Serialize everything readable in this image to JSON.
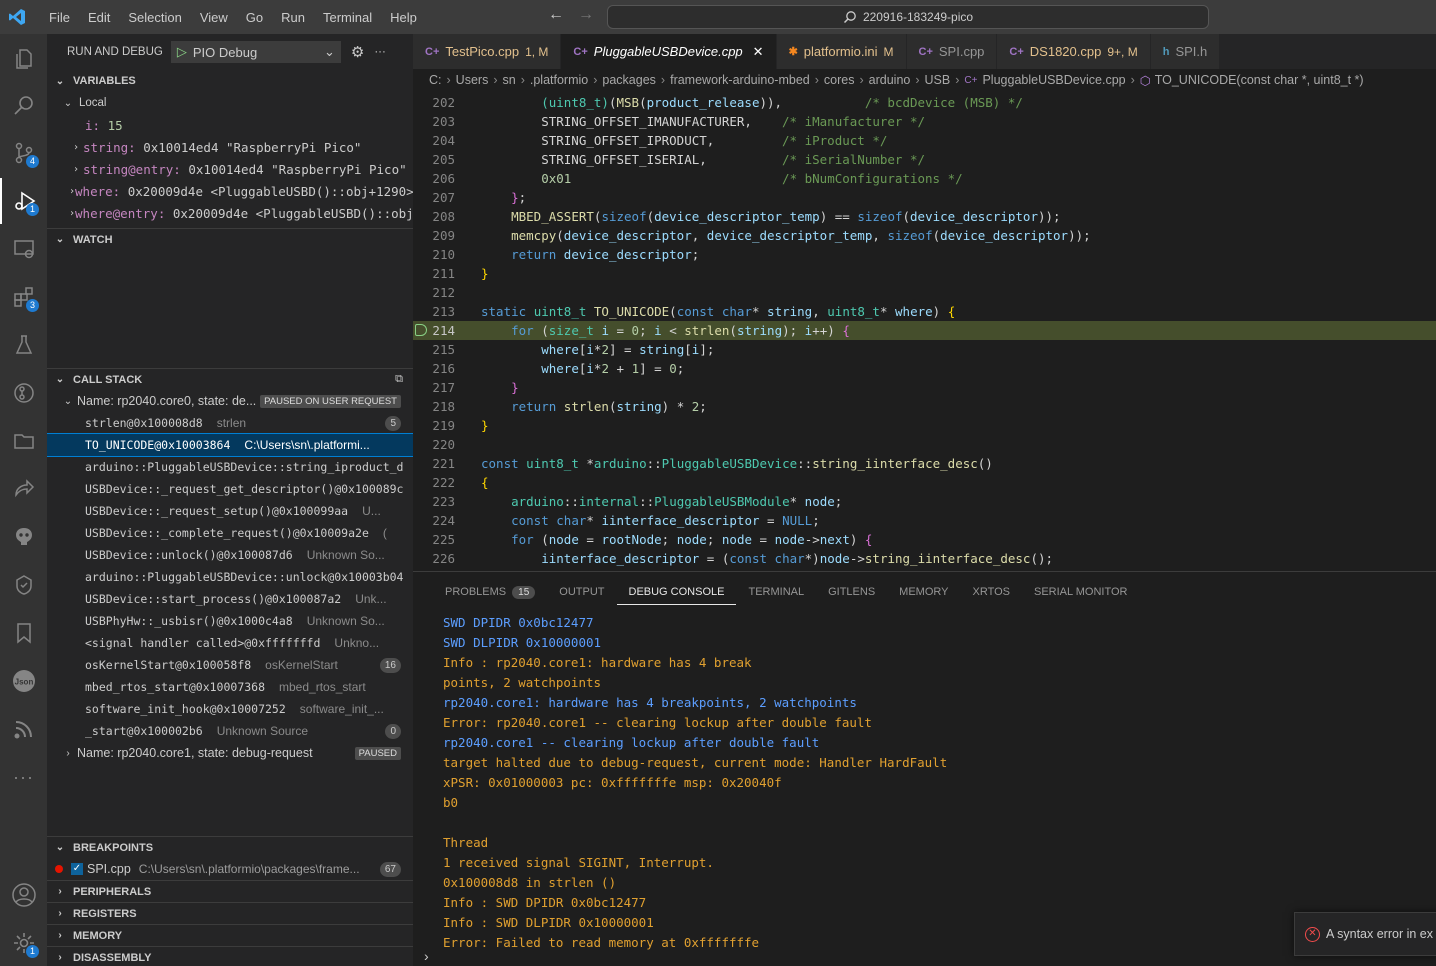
{
  "titlebar": {
    "menus": [
      "File",
      "Edit",
      "Selection",
      "View",
      "Go",
      "Run",
      "Terminal",
      "Help"
    ],
    "search": "220916-183249-pico"
  },
  "activity": {
    "badges": {
      "scm": "4",
      "debug": "1",
      "extensions": "3",
      "settings": "1"
    }
  },
  "sidebar": {
    "header": "RUN AND DEBUG",
    "config": "PIO Debug",
    "variables_title": "VARIABLES",
    "local_title": "Local",
    "vars": [
      {
        "name": "i:",
        "value": "15"
      },
      {
        "name": "string:",
        "value": "0x10014ed4 \"RaspberryPi Pico\""
      },
      {
        "name": "string@entry:",
        "value": "0x10014ed4 \"RaspberryPi Pico\""
      },
      {
        "name": "where:",
        "value": "0x20009d4e <PluggableUSBD()::obj+1290>..."
      },
      {
        "name": "where@entry:",
        "value": "0x20009d4e <PluggableUSBD()::obj..."
      }
    ],
    "watch_title": "WATCH",
    "callstack_title": "CALL STACK",
    "thread0": "Name: rp2040.core0, state: de...",
    "thread0_state": "PAUSED ON USER REQUEST",
    "frames": [
      {
        "fn": "strlen@0x100008d8",
        "src": "strlen",
        "count": "5"
      },
      {
        "fn": "TO_UNICODE@0x10003864",
        "src": "C:\\Users\\sn\\.platformi...",
        "count": ""
      },
      {
        "fn": "arduino::PluggableUSBDevice::string_iproduct_d",
        "src": "",
        "count": ""
      },
      {
        "fn": "USBDevice::_request_get_descriptor()@0x100089c",
        "src": "",
        "count": ""
      },
      {
        "fn": "USBDevice::_request_setup()@0x100099aa",
        "src": "U...",
        "count": ""
      },
      {
        "fn": "USBDevice::_complete_request()@0x10009a2e",
        "src": "(",
        "count": ""
      },
      {
        "fn": "USBDevice::unlock()@0x100087d6",
        "src": "Unknown So...",
        "count": ""
      },
      {
        "fn": "arduino::PluggableUSBDevice::unlock@0x10003b04",
        "src": "",
        "count": ""
      },
      {
        "fn": "USBDevice::start_process()@0x100087a2",
        "src": "Unk...",
        "count": ""
      },
      {
        "fn": "USBPhyHw::_usbisr()@0x1000c4a8",
        "src": "Unknown So...",
        "count": ""
      },
      {
        "fn": "<signal handler called>@0xfffffffd",
        "src": "Unkno...",
        "count": ""
      },
      {
        "fn": "osKernelStart@0x100058f8",
        "src": "osKernelStart",
        "count": "16"
      },
      {
        "fn": "mbed_rtos_start@0x10007368",
        "src": "mbed_rtos_start",
        "count": ""
      },
      {
        "fn": "software_init_hook@0x10007252",
        "src": "software_init_...",
        "count": ""
      },
      {
        "fn": "_start@0x100002b6",
        "src": "Unknown Source",
        "count": "0"
      }
    ],
    "thread1": "Name: rp2040.core1, state: debug-request",
    "thread1_state": "PAUSED",
    "breakpoints_title": "BREAKPOINTS",
    "breakpoint": {
      "file": "SPI.cpp",
      "path": "C:\\Users\\sn\\.platformio\\packages\\frame...",
      "line": "67"
    },
    "peripherals": "PERIPHERALS",
    "registers": "REGISTERS",
    "memory": "MEMORY",
    "disassembly": "DISASSEMBLY"
  },
  "tabs": [
    {
      "label": "TestPico.cpp",
      "suffix": "1, M",
      "icon": "C+"
    },
    {
      "label": "PluggableUSBDevice.cpp",
      "suffix": "",
      "icon": "C+"
    },
    {
      "label": "platformio.ini",
      "suffix": "M",
      "icon": "✱"
    },
    {
      "label": "SPI.cpp",
      "suffix": "",
      "icon": "C+"
    },
    {
      "label": "DS1820.cpp",
      "suffix": "9+, M",
      "icon": "C+"
    },
    {
      "label": "SPI.h",
      "suffix": "",
      "icon": "h"
    }
  ],
  "breadcrumb": [
    "C:",
    "Users",
    "sn",
    ".platformio",
    "packages",
    "framework-arduino-mbed",
    "cores",
    "arduino",
    "USB",
    "PluggableUSBDevice.cpp",
    "TO_UNICODE(const char *, uint8_t *)"
  ],
  "editor": {
    "line_numbers": [
      "202",
      "203",
      "204",
      "205",
      "206",
      "207",
      "208",
      "209",
      "210",
      "211",
      "212",
      "213",
      "214",
      "215",
      "216",
      "217",
      "218",
      "219",
      "220",
      "221",
      "222",
      "223",
      "224",
      "225",
      "226"
    ]
  },
  "panel": {
    "tabs": [
      "PROBLEMS",
      "OUTPUT",
      "DEBUG CONSOLE",
      "TERMINAL",
      "GITLENS",
      "MEMORY",
      "XRTOS",
      "SERIAL MONITOR"
    ],
    "problems_count": "15",
    "console": [
      {
        "t": "SWD DPIDR 0x0bc12477",
        "c": "blue"
      },
      {
        "t": "SWD DLPIDR 0x10000001",
        "c": "blue"
      },
      {
        "t": "Info : rp2040.core1: hardware has 4 break",
        "c": "orange"
      },
      {
        "t": "points, 2 watchpoints",
        "c": "orange"
      },
      {
        "t": "rp2040.core1: hardware has 4 breakpoints, 2 watchpoints",
        "c": "blue"
      },
      {
        "t": "Error: rp2040.core1 -- clearing lockup after double fault",
        "c": "orange"
      },
      {
        "t": "rp2040.core1 -- clearing lockup after double fault",
        "c": "blue"
      },
      {
        "t": "target halted due to debug-request, current mode: Handler HardFault",
        "c": "orange"
      },
      {
        "t": "xPSR: 0x01000003 pc: 0xfffffffe msp: 0x20040f",
        "c": "orange"
      },
      {
        "t": "b0",
        "c": "orange"
      },
      {
        "t": "",
        "c": "orange"
      },
      {
        "t": "Thread",
        "c": "orange"
      },
      {
        "t": "1 received signal SIGINT, Interrupt.",
        "c": "orange"
      },
      {
        "t": "0x100008d8 in strlen ()",
        "c": "orange"
      },
      {
        "t": "Info : SWD DPIDR 0x0bc12477",
        "c": "orange"
      },
      {
        "t": "Info : SWD DLPIDR 0x10000001",
        "c": "orange"
      },
      {
        "t": "Error: Failed to read memory at 0xfffffffe",
        "c": "orange"
      }
    ]
  },
  "toast": "A syntax error in ex",
  "colors": {
    "accent": "#007acc",
    "current_line": "#454e2c",
    "selection": "#04395e"
  }
}
